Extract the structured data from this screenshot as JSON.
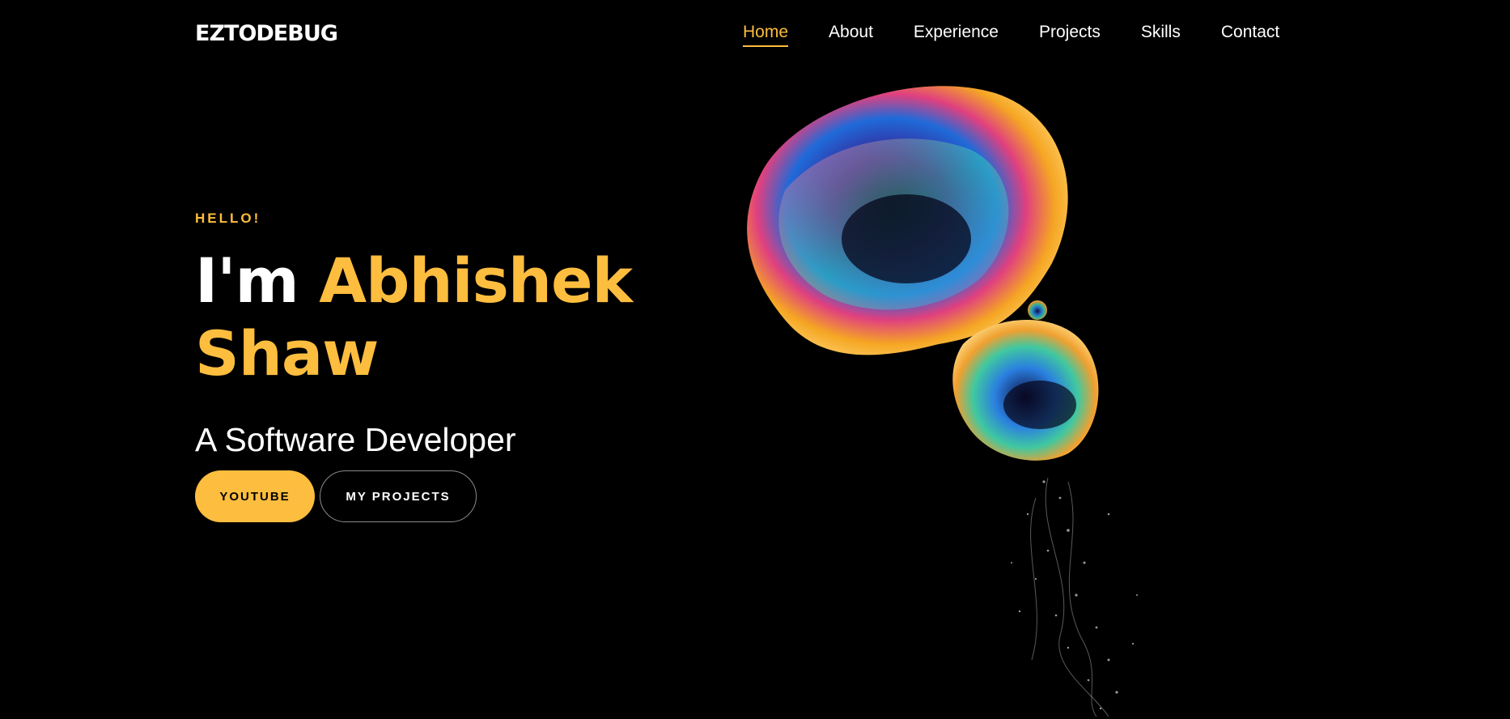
{
  "brand": {
    "logo": "EZTODEBUG"
  },
  "nav": {
    "items": [
      {
        "label": "Home",
        "active": true
      },
      {
        "label": "About",
        "active": false
      },
      {
        "label": "Experience",
        "active": false
      },
      {
        "label": "Projects",
        "active": false
      },
      {
        "label": "Skills",
        "active": false
      },
      {
        "label": "Contact",
        "active": false
      }
    ]
  },
  "hero": {
    "greeting": "HELLO!",
    "intro": "I'm",
    "first_name": "Abhishek",
    "last_name": "Shaw",
    "role": "A Software Developer",
    "buttons": {
      "youtube": "YOUTUBE",
      "projects": "MY PROJECTS"
    },
    "art_icon": "iridescent-bubble-image"
  },
  "colors": {
    "accent": "#fdbd3e",
    "background": "#000000",
    "text": "#ffffff"
  }
}
